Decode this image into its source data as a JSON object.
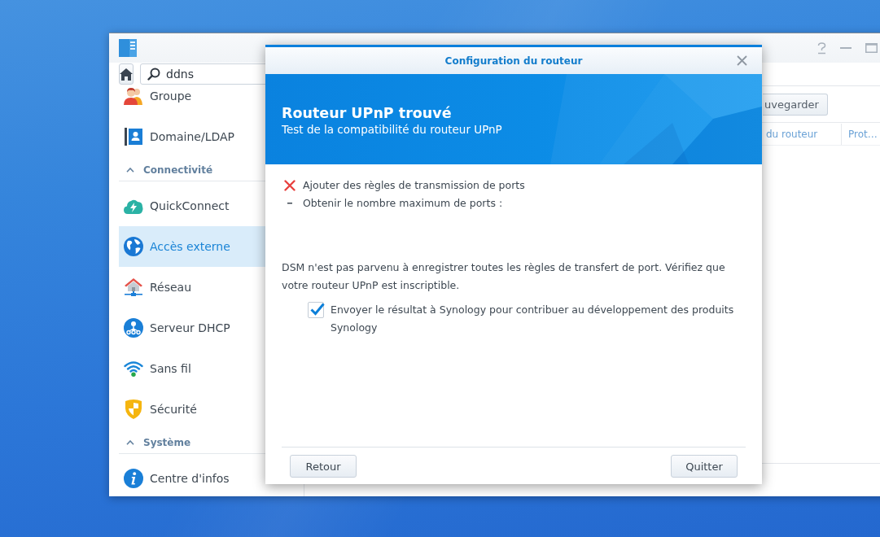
{
  "window": {
    "search": {
      "value": "ddns"
    },
    "sidebar": {
      "entries": [
        {
          "kind": "item",
          "label": "Groupe",
          "selected": false
        },
        {
          "kind": "item",
          "label": "Domaine/LDAP",
          "selected": false
        },
        {
          "kind": "section",
          "label": "Connectivité",
          "expanded": true
        },
        {
          "kind": "item",
          "label": "QuickConnect",
          "selected": false
        },
        {
          "kind": "item",
          "label": "Accès externe",
          "selected": true
        },
        {
          "kind": "item",
          "label": "Réseau",
          "selected": false
        },
        {
          "kind": "item",
          "label": "Serveur DHCP",
          "selected": false
        },
        {
          "kind": "item",
          "label": "Sans fil",
          "selected": false
        },
        {
          "kind": "item",
          "label": "Sécurité",
          "selected": false
        },
        {
          "kind": "section",
          "label": "Système",
          "expanded": true
        },
        {
          "kind": "item",
          "label": "Centre d'infos",
          "selected": false
        }
      ]
    },
    "toolbar": {
      "button": "uvegarder"
    },
    "columns": [
      "du routeur",
      "Prot…"
    ]
  },
  "dialog": {
    "title": "Configuration du routeur",
    "banner": {
      "title": "Routeur UPnP trouvé",
      "subtitle": "Test de la compatibilité du routeur UPnP"
    },
    "steps": [
      {
        "kind": "failed",
        "text": "Ajouter des règles de transmission de ports"
      },
      {
        "kind": "pending",
        "text": "Obtenir le nombre maximum de ports :"
      }
    ],
    "message": "DSM n'est pas parvenu à enregistrer toutes les règles de transfert de port. Vérifiez que votre routeur UPnP est inscriptible.",
    "checkbox": {
      "label": "Envoyer le résultat à Synology pour contribuer au développement des produits Synology",
      "checked": true
    },
    "buttons": [
      "Retour",
      "Quitter"
    ]
  }
}
